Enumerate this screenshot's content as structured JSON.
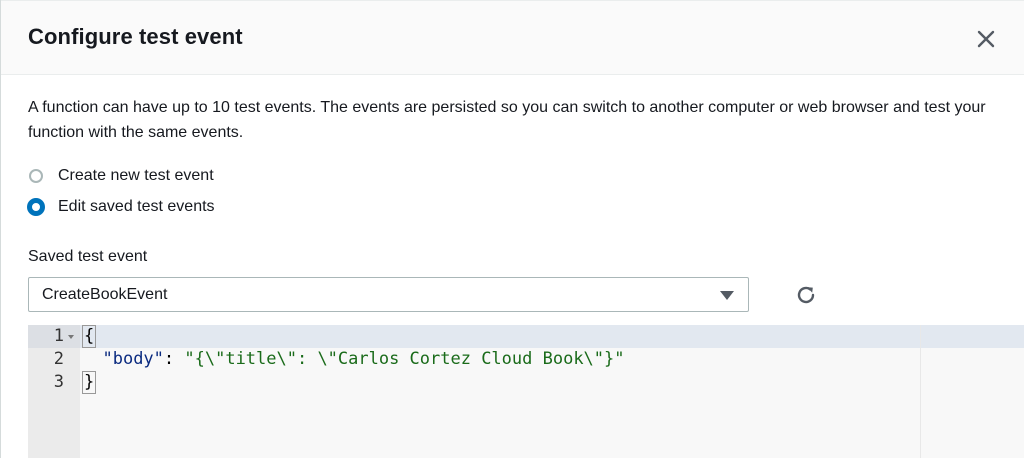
{
  "modal": {
    "title": "Configure test event",
    "close_icon": "close-icon"
  },
  "description": "A function can have up to 10 test events. The events are persisted so you can switch to another computer or web browser and test your function with the same events.",
  "options": [
    {
      "label": "Create new test event",
      "checked": false
    },
    {
      "label": "Edit saved test events",
      "checked": true
    }
  ],
  "saved_event": {
    "label": "Saved test event",
    "selected": "CreateBookEvent",
    "refresh_icon": "refresh-icon"
  },
  "editor": {
    "line_numbers": [
      "1",
      "2",
      "3"
    ],
    "open_brace": "{",
    "close_brace": "}",
    "key": "\"body\"",
    "colon": ": ",
    "value": "\"{\\\"title\\\": \\\"Carlos Cortez Cloud Book\\\"}\""
  },
  "colors": {
    "accent": "#0073bb",
    "text": "#16191f",
    "border": "#aab7b8"
  }
}
